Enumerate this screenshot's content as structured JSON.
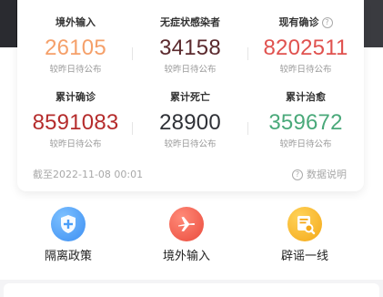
{
  "stats": {
    "imported": {
      "label": "境外输入",
      "value": "26105",
      "sub": "较昨日待公布",
      "color": "#f5a06a"
    },
    "asymptomatic": {
      "label": "无症状感染者",
      "value": "34158",
      "sub": "较昨日待公布",
      "color": "#5b2a2e"
    },
    "current": {
      "label": "现有确诊",
      "value": "8202511",
      "sub": "较昨日待公布",
      "color": "#e0524f"
    },
    "total_confirmed": {
      "label": "累计确诊",
      "value": "8591083",
      "sub": "较昨日待公布",
      "color": "#b52c2c"
    },
    "deaths": {
      "label": "累计死亡",
      "value": "28900",
      "sub": "较昨日待公布",
      "color": "#2f3137"
    },
    "cured": {
      "label": "累计治愈",
      "value": "359672",
      "sub": "较昨日待公布",
      "color": "#4aa97a"
    }
  },
  "footer": {
    "timestamp": "截至2022-11-08 00:01",
    "explain": "数据说明"
  },
  "shortcuts": [
    {
      "label": "隔离政策",
      "icon": "shield-plus-icon",
      "color": "#4a9ef8"
    },
    {
      "label": "境外输入",
      "icon": "airplane-icon",
      "color": "#f05a4a"
    },
    {
      "label": "辟谣一线",
      "icon": "search-document-icon",
      "color": "#f7b21e"
    }
  ]
}
